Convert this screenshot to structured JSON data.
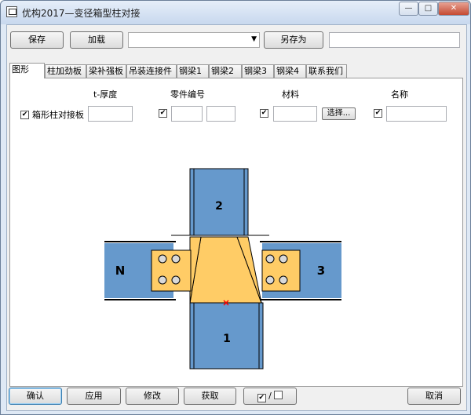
{
  "window": {
    "title": "优构2017—变径箱型柱对接"
  },
  "toolbar": {
    "save_label": "保存",
    "load_label": "加载",
    "save_as_label": "另存为",
    "preset_value": "",
    "name_value": ""
  },
  "tabs": [
    {
      "label": "图形",
      "active": true
    },
    {
      "label": "柱加劲板",
      "active": false
    },
    {
      "label": "梁补强板",
      "active": false
    },
    {
      "label": "吊装连接件",
      "active": false
    },
    {
      "label": "钢梁1",
      "active": false
    },
    {
      "label": "钢梁2",
      "active": false
    },
    {
      "label": "钢梁3",
      "active": false
    },
    {
      "label": "钢梁4",
      "active": false
    },
    {
      "label": "联系我们",
      "active": false
    }
  ],
  "form": {
    "headers": {
      "thickness": "t-厚度",
      "part_no": "零件编号",
      "material": "材料",
      "name": "名称"
    },
    "row_label": "箱形柱对接板",
    "select_label": "选择..."
  },
  "diagram": {
    "labels": {
      "top": "2",
      "bottom": "1",
      "left": "N",
      "right": "3"
    },
    "colors": {
      "beam": "#6699cc",
      "plate": "#ffcc66",
      "bolt": "#d9d9d9",
      "marker": "#ff0000"
    }
  },
  "footer": {
    "confirm_label": "确认",
    "apply_label": "应用",
    "modify_label": "修改",
    "fetch_label": "获取",
    "toggle_slash": "/",
    "cancel_label": "取消"
  }
}
